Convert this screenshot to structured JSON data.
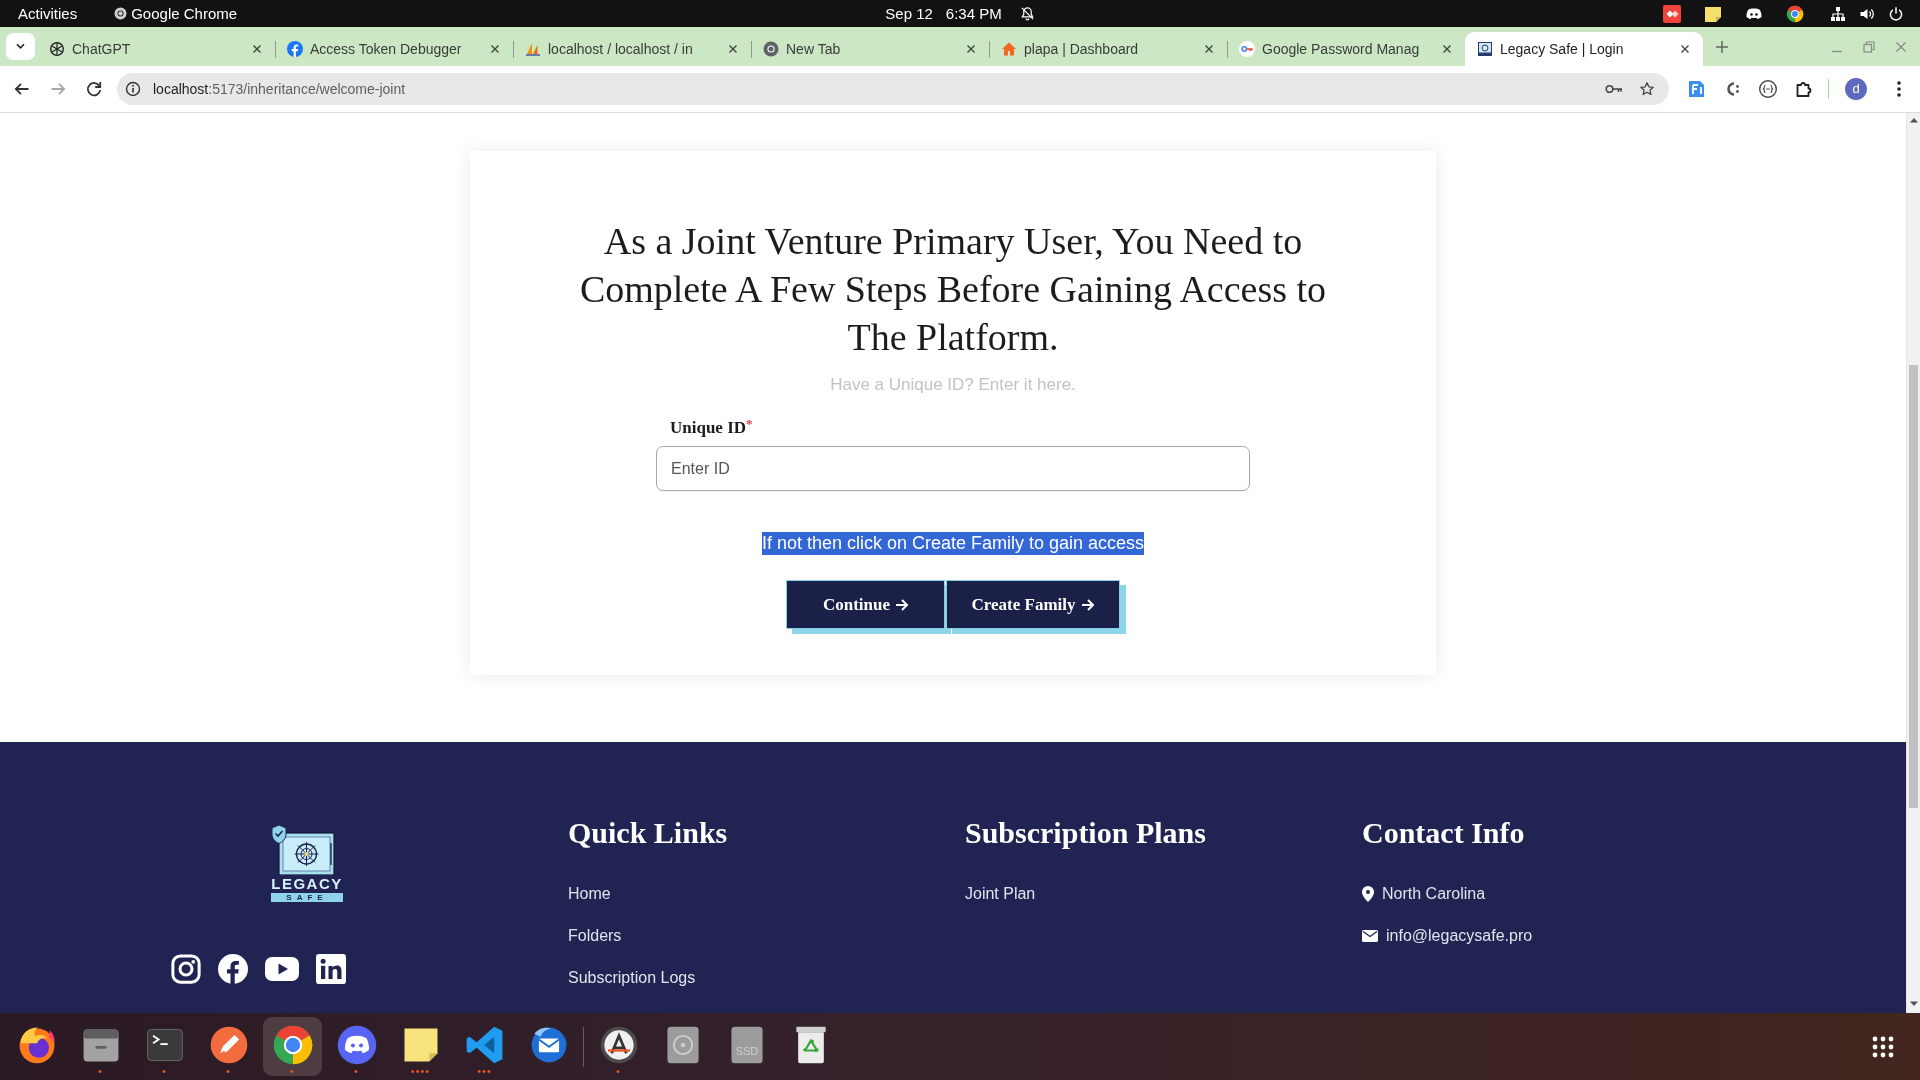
{
  "system_bar": {
    "activities": "Activities",
    "app_name": "Google Chrome",
    "date": "Sep 12",
    "time": "6:34 PM"
  },
  "browser": {
    "tabs": [
      {
        "kind": "knot",
        "title": "ChatGPT",
        "selected": false
      },
      {
        "kind": "facebook",
        "title": "Access Token Debugger",
        "selected": false
      },
      {
        "kind": "sails",
        "title": "localhost / localhost / in",
        "selected": false
      },
      {
        "kind": "chrome",
        "title": "New Tab",
        "selected": false
      },
      {
        "kind": "house",
        "title": "plapa | Dashboard",
        "selected": false
      },
      {
        "kind": "key",
        "title": "Google Password Manag",
        "selected": false
      },
      {
        "kind": "safe",
        "title": "Legacy Safe | Login",
        "selected": true
      }
    ],
    "address": {
      "host": "localhost",
      "path": ":5173/inheritance/welcome-joint"
    },
    "profile_initial": "d"
  },
  "page": {
    "heading": "As a Joint Venture Primary User, You Need to Complete A Few Steps Before Gaining Access to The Platform.",
    "subtitle": "Have a Unique ID? Enter it here.",
    "field": {
      "label": "Unique ID",
      "required_mark": "*",
      "placeholder": "Enter ID"
    },
    "note": {
      "text": "If not then click on Create Family to gain access",
      "highlighted": true
    },
    "buttons": [
      "Continue",
      "Create Family"
    ]
  },
  "footer": {
    "logo": {
      "wordmark": "LEGACY",
      "tagline": "SAFE"
    },
    "columns": [
      {
        "title": "Quick Links",
        "items": [
          {
            "kind": "link",
            "text": "Home"
          },
          {
            "kind": "link",
            "text": "Folders"
          },
          {
            "kind": "link",
            "text": "Subscription Logs"
          }
        ]
      },
      {
        "title": "Subscription Plans",
        "items": [
          {
            "kind": "link",
            "text": "Joint Plan"
          }
        ]
      },
      {
        "title": "Contact Info",
        "items": [
          {
            "kind": "location",
            "text": "North Carolina"
          },
          {
            "kind": "email",
            "text": "info@legacysafe.pro"
          }
        ]
      }
    ]
  },
  "dock": {
    "pinned": [
      {
        "kind": "firefox",
        "selected": false
      },
      {
        "kind": "files",
        "indicator": "•",
        "selected": false
      },
      {
        "kind": "terminal",
        "indicator": "•",
        "selected": false
      },
      {
        "kind": "pen",
        "indicator": "•",
        "selected": false
      },
      {
        "kind": "chrome",
        "indicator": "•",
        "selected": true
      },
      {
        "kind": "discord",
        "indicator": "•",
        "selected": false
      },
      {
        "kind": "notes",
        "indicator": "••••",
        "selected": false
      },
      {
        "kind": "code",
        "indicator": "•••",
        "selected": false
      },
      {
        "kind": "mail",
        "selected": false
      }
    ],
    "other": [
      {
        "kind": "updater",
        "indicator": "•",
        "selected": false
      },
      {
        "kind": "disc",
        "selected": false
      },
      {
        "kind": "drive",
        "label": "SSD",
        "selected": false
      },
      {
        "kind": "trash",
        "selected": false
      }
    ]
  }
}
